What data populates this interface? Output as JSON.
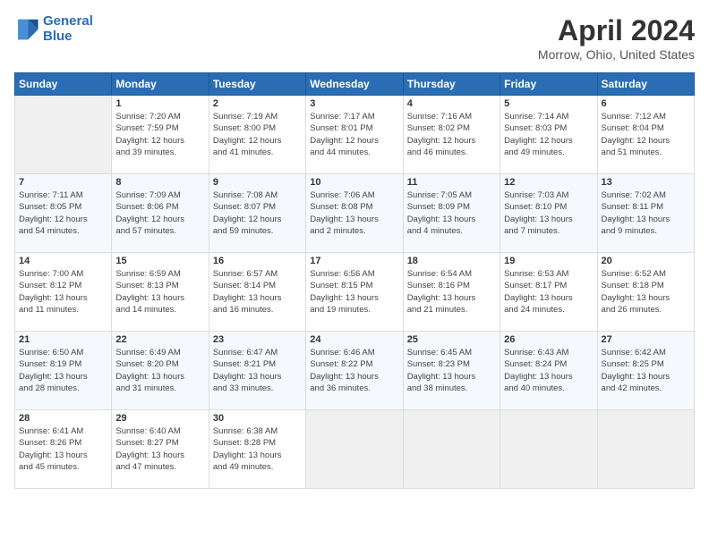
{
  "header": {
    "logo_line1": "General",
    "logo_line2": "Blue",
    "month_title": "April 2024",
    "location": "Morrow, Ohio, United States"
  },
  "weekdays": [
    "Sunday",
    "Monday",
    "Tuesday",
    "Wednesday",
    "Thursday",
    "Friday",
    "Saturday"
  ],
  "weeks": [
    [
      {
        "day": "",
        "info": ""
      },
      {
        "day": "1",
        "info": "Sunrise: 7:20 AM\nSunset: 7:59 PM\nDaylight: 12 hours\nand 39 minutes."
      },
      {
        "day": "2",
        "info": "Sunrise: 7:19 AM\nSunset: 8:00 PM\nDaylight: 12 hours\nand 41 minutes."
      },
      {
        "day": "3",
        "info": "Sunrise: 7:17 AM\nSunset: 8:01 PM\nDaylight: 12 hours\nand 44 minutes."
      },
      {
        "day": "4",
        "info": "Sunrise: 7:16 AM\nSunset: 8:02 PM\nDaylight: 12 hours\nand 46 minutes."
      },
      {
        "day": "5",
        "info": "Sunrise: 7:14 AM\nSunset: 8:03 PM\nDaylight: 12 hours\nand 49 minutes."
      },
      {
        "day": "6",
        "info": "Sunrise: 7:12 AM\nSunset: 8:04 PM\nDaylight: 12 hours\nand 51 minutes."
      }
    ],
    [
      {
        "day": "7",
        "info": "Sunrise: 7:11 AM\nSunset: 8:05 PM\nDaylight: 12 hours\nand 54 minutes."
      },
      {
        "day": "8",
        "info": "Sunrise: 7:09 AM\nSunset: 8:06 PM\nDaylight: 12 hours\nand 57 minutes."
      },
      {
        "day": "9",
        "info": "Sunrise: 7:08 AM\nSunset: 8:07 PM\nDaylight: 12 hours\nand 59 minutes."
      },
      {
        "day": "10",
        "info": "Sunrise: 7:06 AM\nSunset: 8:08 PM\nDaylight: 13 hours\nand 2 minutes."
      },
      {
        "day": "11",
        "info": "Sunrise: 7:05 AM\nSunset: 8:09 PM\nDaylight: 13 hours\nand 4 minutes."
      },
      {
        "day": "12",
        "info": "Sunrise: 7:03 AM\nSunset: 8:10 PM\nDaylight: 13 hours\nand 7 minutes."
      },
      {
        "day": "13",
        "info": "Sunrise: 7:02 AM\nSunset: 8:11 PM\nDaylight: 13 hours\nand 9 minutes."
      }
    ],
    [
      {
        "day": "14",
        "info": "Sunrise: 7:00 AM\nSunset: 8:12 PM\nDaylight: 13 hours\nand 11 minutes."
      },
      {
        "day": "15",
        "info": "Sunrise: 6:59 AM\nSunset: 8:13 PM\nDaylight: 13 hours\nand 14 minutes."
      },
      {
        "day": "16",
        "info": "Sunrise: 6:57 AM\nSunset: 8:14 PM\nDaylight: 13 hours\nand 16 minutes."
      },
      {
        "day": "17",
        "info": "Sunrise: 6:56 AM\nSunset: 8:15 PM\nDaylight: 13 hours\nand 19 minutes."
      },
      {
        "day": "18",
        "info": "Sunrise: 6:54 AM\nSunset: 8:16 PM\nDaylight: 13 hours\nand 21 minutes."
      },
      {
        "day": "19",
        "info": "Sunrise: 6:53 AM\nSunset: 8:17 PM\nDaylight: 13 hours\nand 24 minutes."
      },
      {
        "day": "20",
        "info": "Sunrise: 6:52 AM\nSunset: 8:18 PM\nDaylight: 13 hours\nand 26 minutes."
      }
    ],
    [
      {
        "day": "21",
        "info": "Sunrise: 6:50 AM\nSunset: 8:19 PM\nDaylight: 13 hours\nand 28 minutes."
      },
      {
        "day": "22",
        "info": "Sunrise: 6:49 AM\nSunset: 8:20 PM\nDaylight: 13 hours\nand 31 minutes."
      },
      {
        "day": "23",
        "info": "Sunrise: 6:47 AM\nSunset: 8:21 PM\nDaylight: 13 hours\nand 33 minutes."
      },
      {
        "day": "24",
        "info": "Sunrise: 6:46 AM\nSunset: 8:22 PM\nDaylight: 13 hours\nand 36 minutes."
      },
      {
        "day": "25",
        "info": "Sunrise: 6:45 AM\nSunset: 8:23 PM\nDaylight: 13 hours\nand 38 minutes."
      },
      {
        "day": "26",
        "info": "Sunrise: 6:43 AM\nSunset: 8:24 PM\nDaylight: 13 hours\nand 40 minutes."
      },
      {
        "day": "27",
        "info": "Sunrise: 6:42 AM\nSunset: 8:25 PM\nDaylight: 13 hours\nand 42 minutes."
      }
    ],
    [
      {
        "day": "28",
        "info": "Sunrise: 6:41 AM\nSunset: 8:26 PM\nDaylight: 13 hours\nand 45 minutes."
      },
      {
        "day": "29",
        "info": "Sunrise: 6:40 AM\nSunset: 8:27 PM\nDaylight: 13 hours\nand 47 minutes."
      },
      {
        "day": "30",
        "info": "Sunrise: 6:38 AM\nSunset: 8:28 PM\nDaylight: 13 hours\nand 49 minutes."
      },
      {
        "day": "",
        "info": ""
      },
      {
        "day": "",
        "info": ""
      },
      {
        "day": "",
        "info": ""
      },
      {
        "day": "",
        "info": ""
      }
    ]
  ]
}
